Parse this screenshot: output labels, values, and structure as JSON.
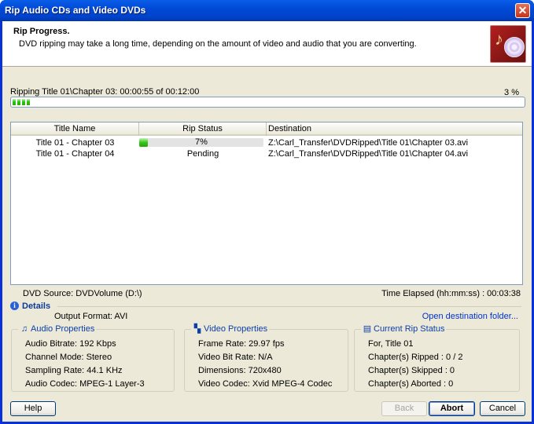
{
  "window": {
    "title": "Rip Audio CDs and Video DVDs"
  },
  "header": {
    "title": "Rip Progress.",
    "subtitle": "DVD ripping may take a long time, depending on the amount of video and audio that you are converting."
  },
  "progress": {
    "label": "Ripping Title 01\\Chapter 03: 00:00:55 of 00:12:00",
    "percent_text": "3 %",
    "fraction": 0.03
  },
  "table": {
    "columns": [
      "Title Name",
      "Rip Status",
      "Destination"
    ],
    "rows": [
      {
        "title": "Title 01 - Chapter 03",
        "status": "7%",
        "status_fraction": 0.07,
        "destination": "Z:\\Carl_Transfer\\DVDRipped\\Title 01\\Chapter 03.avi"
      },
      {
        "title": "Title 01 - Chapter 04",
        "status": "Pending",
        "destination": "Z:\\Carl_Transfer\\DVDRipped\\Title 01\\Chapter 04.avi"
      }
    ]
  },
  "info": {
    "dvd_source": "DVD Source: DVDVolume (D:\\)",
    "time_elapsed": "Time Elapsed (hh:mm:ss) :  00:03:38"
  },
  "details": {
    "label": "Details",
    "output_format": "Output Format: AVI",
    "open_folder": "Open destination folder..."
  },
  "audio": {
    "title": "Audio Properties",
    "lines": [
      "Audio Bitrate: 192 Kbps",
      "Channel Mode: Stereo",
      "Sampling Rate: 44.1 KHz",
      "Audio Codec: MPEG-1 Layer-3"
    ]
  },
  "video": {
    "title": "Video Properties",
    "lines": [
      "Frame Rate: 29.97 fps",
      "Video Bit Rate: N/A",
      "Dimensions: 720x480",
      "Video Codec: Xvid MPEG-4 Codec"
    ]
  },
  "current": {
    "title": "Current Rip Status",
    "lines": [
      "For, Title 01",
      "Chapter(s) Ripped : 0 / 2",
      "Chapter(s) Skipped : 0",
      "Chapter(s) Aborted : 0"
    ]
  },
  "buttons": {
    "help": "Help",
    "back": "Back",
    "abort": "Abort",
    "cancel": "Cancel"
  },
  "icons": {
    "close": "close-icon",
    "info": "info-icon",
    "audio": "audio-note-icon",
    "video": "film-clapper-icon",
    "status": "rip-status-icon"
  },
  "colors": {
    "titlebar": "#0049d6",
    "progress": "#2fc40f",
    "link": "#0033cc",
    "group_title": "#0c3ea8"
  }
}
